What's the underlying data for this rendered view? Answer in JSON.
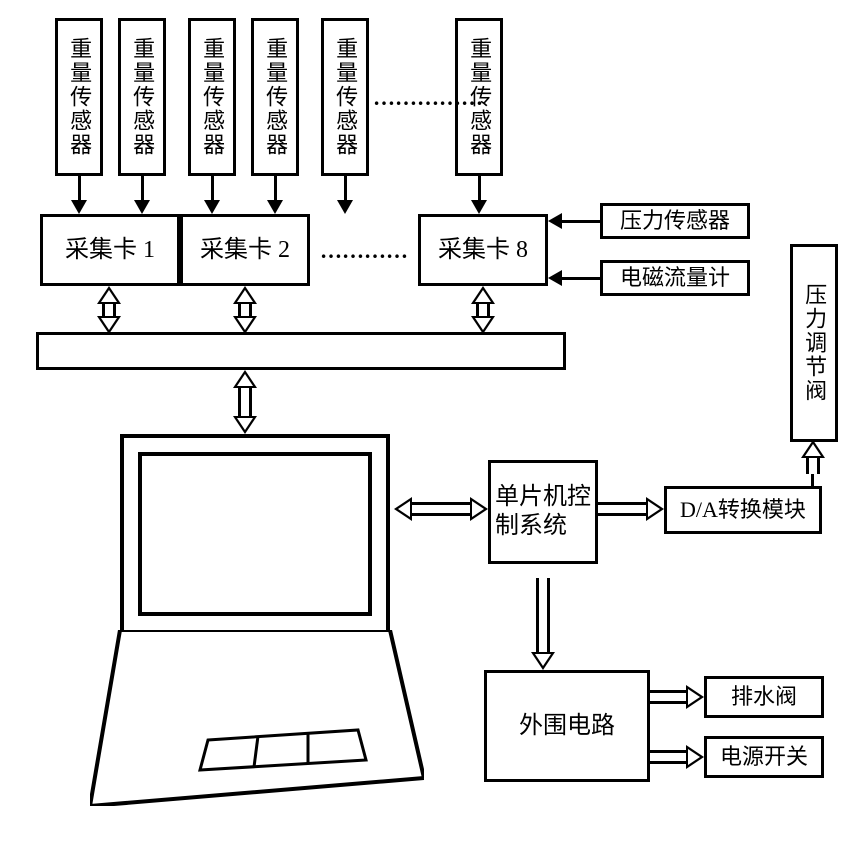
{
  "sensors": {
    "label": "重量传感器",
    "ellipsis": "……………"
  },
  "cards": {
    "c1": "采集卡 1",
    "c2": "采集卡 2",
    "c8": "采集卡 8",
    "ellipsis": "…………"
  },
  "side_inputs": {
    "pressure_sensor": "压力传感器",
    "flow_meter": "电磁流量计"
  },
  "mcu": "单片机控制系统",
  "da": "D/A转换模块",
  "valve": "压力调节阀",
  "periph": "外围电路",
  "drain": "排水阀",
  "power": "电源开关"
}
